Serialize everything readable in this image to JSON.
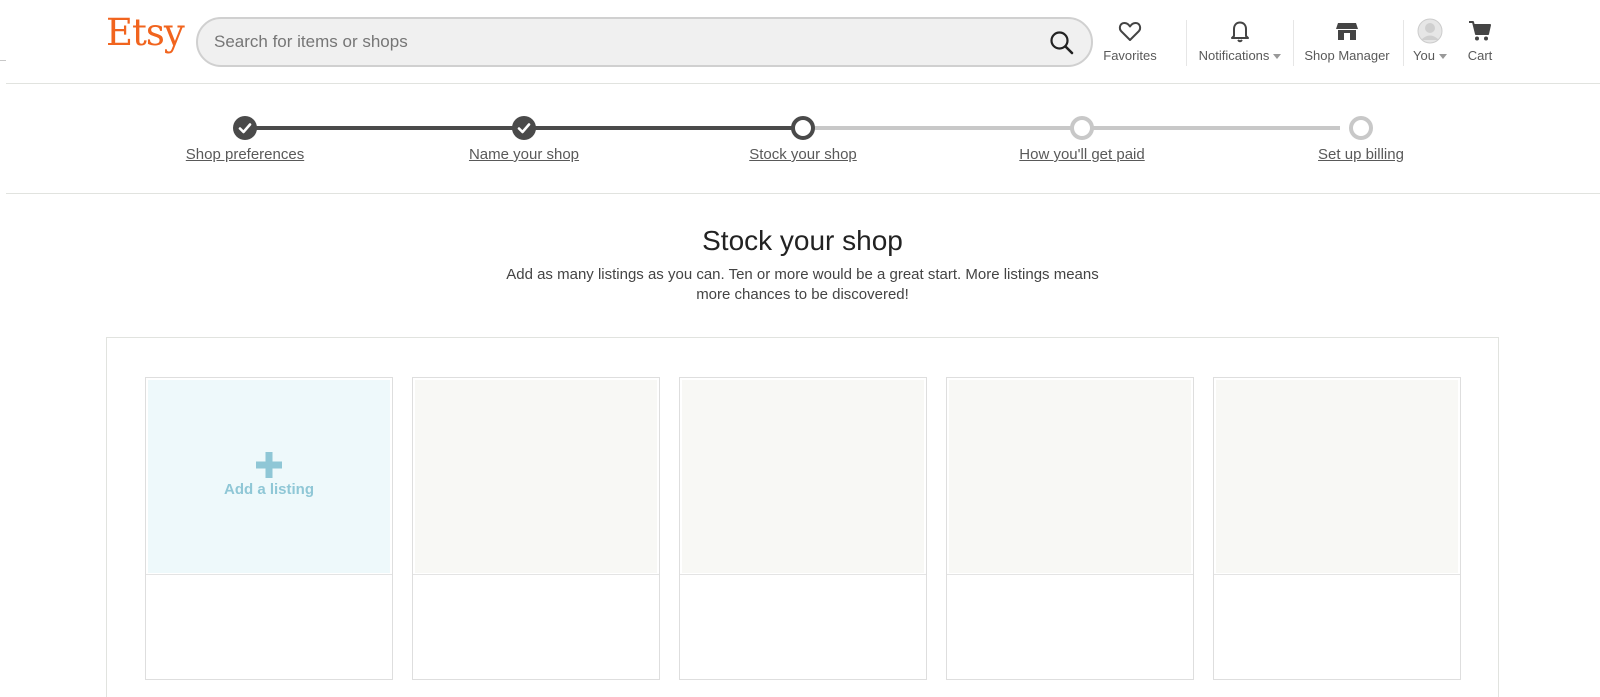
{
  "header": {
    "logo": "Etsy",
    "search": {
      "placeholder": "Search for items or shops",
      "icon": "search-icon"
    },
    "nav": [
      {
        "label": "Favorites",
        "icon": "heart-icon"
      },
      {
        "label": "Notifications",
        "icon": "bell-icon",
        "dropdown": true
      },
      {
        "label": "Shop Manager",
        "icon": "shop-icon"
      },
      {
        "label": "You",
        "icon": "avatar-icon",
        "dropdown": true
      },
      {
        "label": "Cart",
        "icon": "cart-icon"
      }
    ]
  },
  "stepper": {
    "steps": [
      {
        "label": "Shop preferences",
        "state": "done"
      },
      {
        "label": "Name your shop",
        "state": "done"
      },
      {
        "label": "Stock your shop",
        "state": "current"
      },
      {
        "label": "How you'll get paid",
        "state": "todo"
      },
      {
        "label": "Set up billing",
        "state": "todo"
      }
    ]
  },
  "main": {
    "title": "Stock your shop",
    "subtitle": "Add as many listings as you can. Ten or more would be a great start. More listings means more chances to be discovered!",
    "add_listing_label": "Add a listing"
  },
  "colors": {
    "brand": "#f1641e",
    "step_done": "#4a4a4a",
    "step_todo": "#c8c8c8",
    "add_accent": "#8fc7d6"
  }
}
